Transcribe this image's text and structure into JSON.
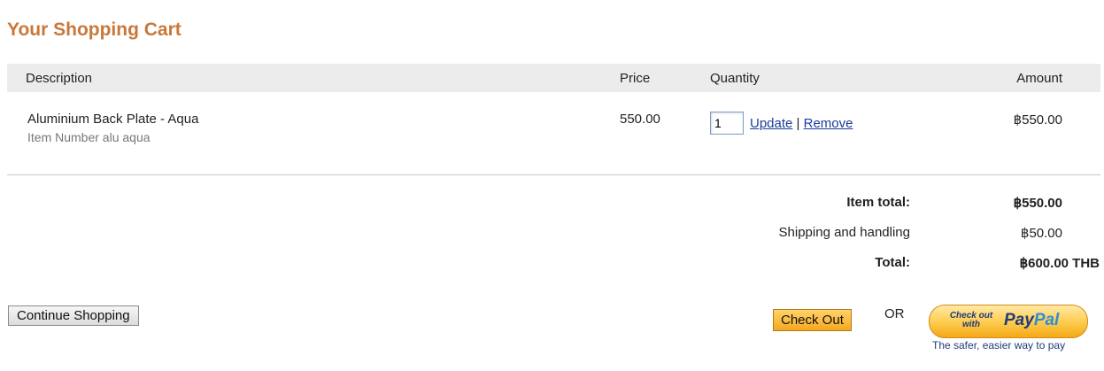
{
  "cart": {
    "title": "Your Shopping Cart",
    "columns": {
      "description": "Description",
      "price": "Price",
      "quantity": "Quantity",
      "amount": "Amount"
    },
    "items": [
      {
        "name": "Aluminium Back Plate - Aqua",
        "item_number": "Item Number alu aqua",
        "price": "550.00",
        "quantity": "1",
        "update_label": "Update",
        "separator": "|",
        "remove_label": "Remove",
        "amount": "฿550.00"
      }
    ],
    "summary": {
      "item_total_label": "Item total:",
      "item_total_value": "฿550.00",
      "shipping_label": "Shipping and handling",
      "shipping_value": "฿50.00",
      "total_label": "Total:",
      "total_value": "฿600.00 THB"
    },
    "actions": {
      "continue_shopping": "Continue Shopping",
      "check_out": "Check Out",
      "or": "OR",
      "paypal_small": "Check out with",
      "paypal_logo_a": "Pay",
      "paypal_logo_b": "Pal",
      "paypal_tagline": "The safer, easier way to pay"
    }
  },
  "colors": {
    "title": "#c8783a",
    "header_bg": "#ececec",
    "link": "#1a3e9e",
    "checkout_button": "#f6a81e",
    "paypal_dark_blue": "#1f3c7a",
    "paypal_light_blue": "#2b8fd6"
  }
}
